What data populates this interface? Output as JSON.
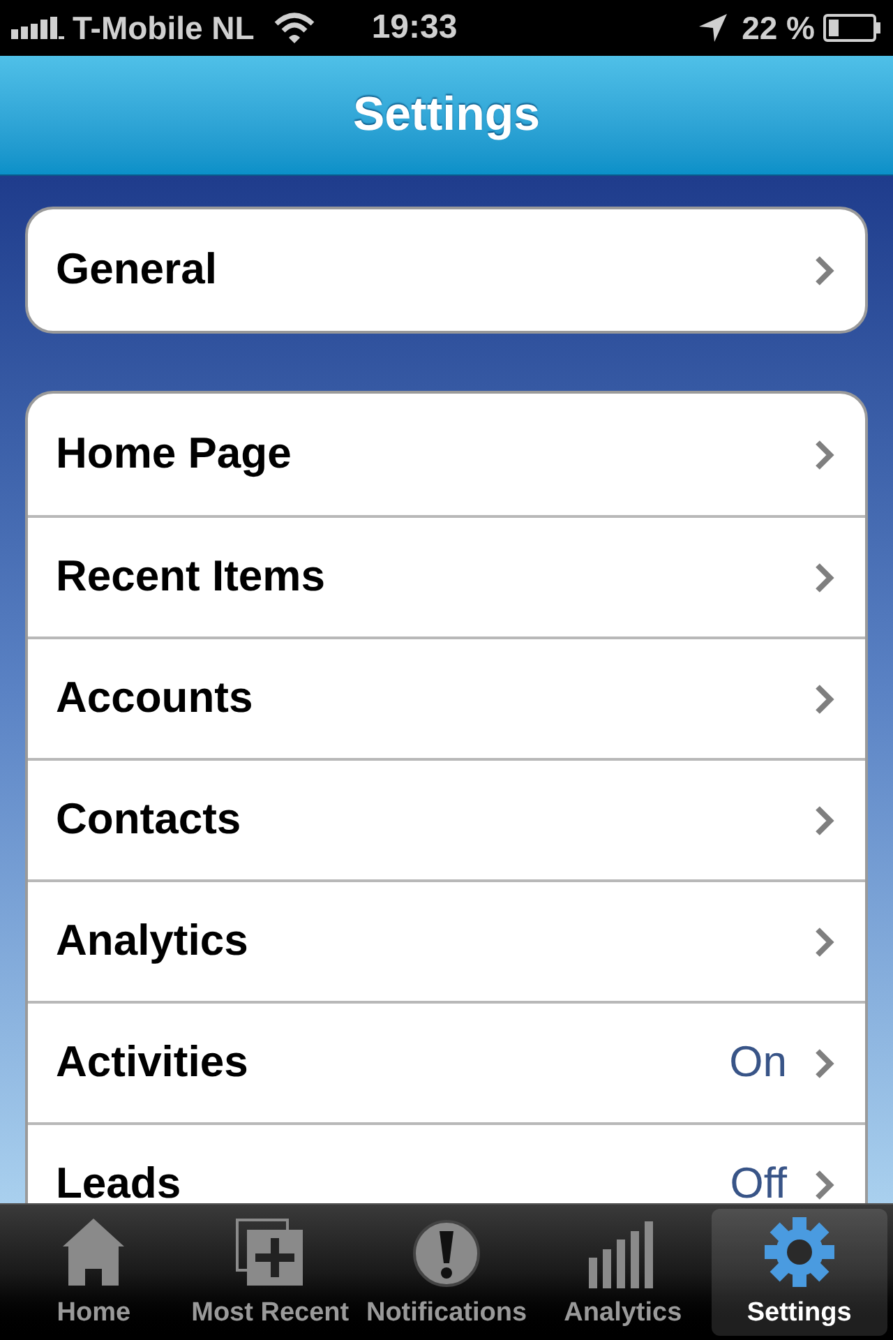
{
  "status_bar": {
    "carrier": "T-Mobile NL",
    "time": "19:33",
    "battery": "22 %"
  },
  "nav_bar": {
    "title": "Settings"
  },
  "groups": [
    {
      "rows": [
        {
          "label": "General"
        }
      ]
    },
    {
      "rows": [
        {
          "label": "Home Page"
        },
        {
          "label": "Recent Items"
        },
        {
          "label": "Accounts"
        },
        {
          "label": "Contacts"
        },
        {
          "label": "Analytics"
        },
        {
          "label": "Activities",
          "value": "On"
        },
        {
          "label": "Leads",
          "value": "Off"
        }
      ]
    }
  ],
  "tab_bar": [
    {
      "label": "Home",
      "kind": "home",
      "selected": false
    },
    {
      "label": "Most Recent",
      "kind": "recent",
      "selected": false
    },
    {
      "label": "Notifications",
      "kind": "alert",
      "selected": false
    },
    {
      "label": "Analytics",
      "kind": "bars",
      "selected": false
    },
    {
      "label": "Settings",
      "kind": "gear",
      "selected": true
    }
  ]
}
